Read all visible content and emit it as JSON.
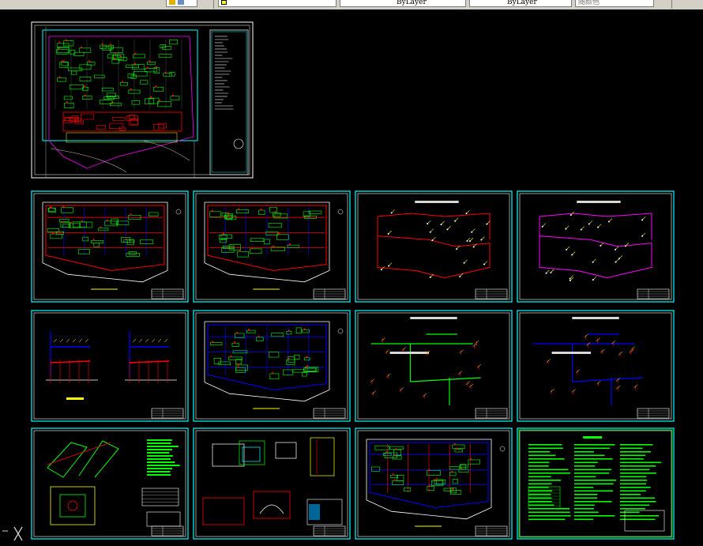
{
  "toolbar": {
    "bylayer_1": "ByLayer",
    "bylayer_2": "ByLayer",
    "plot_style": "随颜色"
  },
  "colors": {
    "canvas": "#000000",
    "frame": "#00ffff",
    "title_block": "#ffffff",
    "water": "#0000ff",
    "fire": "#ff0000",
    "drain": "#00ff00",
    "gas": "#ff00ff",
    "road": "#ffffff",
    "building": "#00ff00"
  },
  "sheets": [
    {
      "id": "overview",
      "kind": "overview"
    },
    {
      "id": "r1c1",
      "kind": "site-plan"
    },
    {
      "id": "r1c2",
      "kind": "site-plan"
    },
    {
      "id": "r1c3",
      "kind": "pipe-red"
    },
    {
      "id": "r1c4",
      "kind": "pipe-magenta"
    },
    {
      "id": "r2c1",
      "kind": "riser"
    },
    {
      "id": "r2c2",
      "kind": "site-plan-blue"
    },
    {
      "id": "r2c3",
      "kind": "pipe-green"
    },
    {
      "id": "r2c4",
      "kind": "pipe-blue"
    },
    {
      "id": "r3c1",
      "kind": "details"
    },
    {
      "id": "r3c2",
      "kind": "details-2"
    },
    {
      "id": "r3c3",
      "kind": "site-plan-2"
    },
    {
      "id": "r3c4",
      "kind": "notes"
    }
  ]
}
